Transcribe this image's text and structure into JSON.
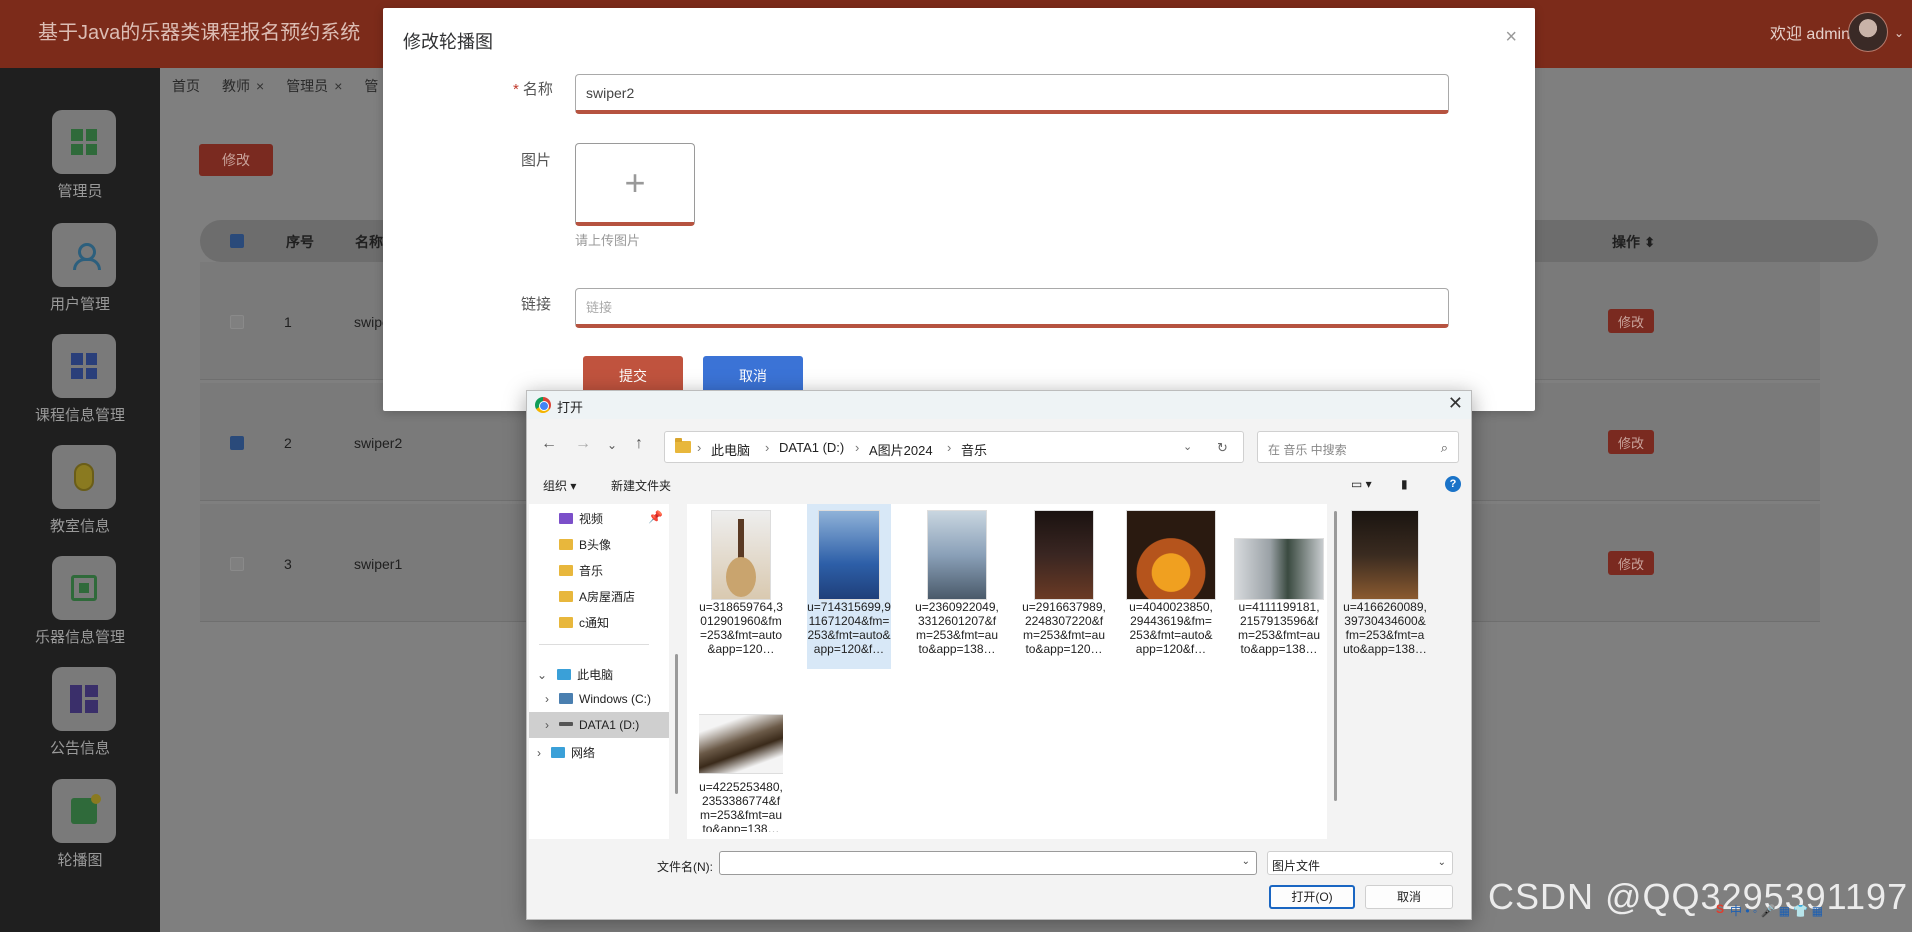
{
  "app": {
    "title": "基于Java的乐器类课程报名预约系统",
    "welcome": "欢迎 admin"
  },
  "sidebar": {
    "items": [
      {
        "label": "管理员",
        "icon": "grid-icon"
      },
      {
        "label": "用户管理",
        "icon": "user-icon"
      },
      {
        "label": "课程信息管理",
        "icon": "grid-icon"
      },
      {
        "label": "教室信息",
        "icon": "mouse-icon"
      },
      {
        "label": "乐器信息管理",
        "icon": "chip-icon"
      },
      {
        "label": "公告信息",
        "icon": "board-icon"
      },
      {
        "label": "轮播图",
        "icon": "image-icon"
      }
    ]
  },
  "tabs": [
    {
      "label": "首页"
    },
    {
      "label": "教师",
      "close": "×"
    },
    {
      "label": "管理员",
      "close": "×"
    },
    {
      "label": "管"
    }
  ],
  "toolbar": {
    "edit_label": "修改"
  },
  "table": {
    "headers": {
      "index": "序号",
      "name": "名称",
      "ops": "操作 ⬍"
    },
    "rows": [
      {
        "index": "1",
        "name": "swipe",
        "checked": false,
        "op": "修改"
      },
      {
        "index": "2",
        "name": "swiper2",
        "checked": true,
        "op": "修改"
      },
      {
        "index": "3",
        "name": "swiper1",
        "checked": false,
        "op": "修改"
      }
    ]
  },
  "modal": {
    "title": "修改轮播图",
    "close": "×",
    "name_label": "名称",
    "name_value": "swiper2",
    "image_label": "图片",
    "upload_plus": "+",
    "upload_hint": "请上传图片",
    "link_label": "链接",
    "link_placeholder": "链接",
    "submit": "提交",
    "cancel": "取消"
  },
  "dialog": {
    "title": "打开",
    "close": "✕",
    "breadcrumb": [
      "此电脑",
      "DATA1 (D:)",
      "A图片2024",
      "音乐"
    ],
    "search_placeholder": "在 音乐 中搜索",
    "organize": "组织 ▾",
    "new_folder": "新建文件夹",
    "nav": [
      {
        "label": "视频"
      },
      {
        "label": "B头像"
      },
      {
        "label": "音乐"
      },
      {
        "label": "A房屋酒店"
      },
      {
        "label": "c通知"
      },
      {
        "label": "此电脑"
      },
      {
        "label": "Windows (C:)"
      },
      {
        "label": "DATA1 (D:)"
      },
      {
        "label": "网络"
      }
    ],
    "files": [
      {
        "name": "u=318659764,3012901960&fm=253&fmt=auto&app=120…",
        "thumb_color": "#d9c9b0"
      },
      {
        "name": "u=714315699,911671204&fm=253&fmt=auto&app=120&f…",
        "thumb_color": "#2d5fa8"
      },
      {
        "name": "u=2360922049,3312601207&fm=253&fmt=auto&app=138…",
        "thumb_color": "#8aa0b8"
      },
      {
        "name": "u=2916637989,2248307220&fm=253&fmt=auto&app=120…",
        "thumb_color": "#3a2622"
      },
      {
        "name": "u=4040023850,29443619&fm=253&fmt=auto&app=120&f…",
        "thumb_color": "#b5541c"
      },
      {
        "name": "u=4111199181,2157913596&fm=253&fmt=auto&app=138…",
        "thumb_color": "#9aa1a6"
      },
      {
        "name": "u=4166260089,39730434600&fm=253&fmt=auto&app=138…",
        "thumb_color": "#3a2b20"
      },
      {
        "name": "u=4225253480,2353386774&fm=253&fmt=auto&app=138…",
        "thumb_color": "#6b5a48"
      }
    ],
    "filename_label": "文件名(N):",
    "filetype": "图片文件",
    "open": "打开(O)",
    "cancel": "取消"
  },
  "watermark": "CSDN @QQ3295391197",
  "ime": "中 • ◦ 🎤 ▦ 👕 ▦"
}
